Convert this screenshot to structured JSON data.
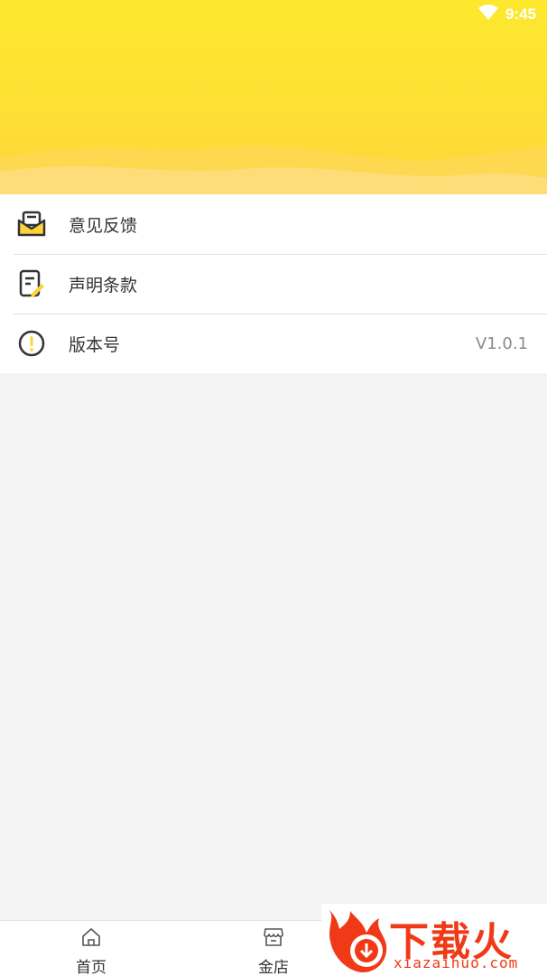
{
  "status_bar": {
    "time": "9:45",
    "wifi_icon": "wifi-icon"
  },
  "menu": {
    "items": [
      {
        "label": "意见反馈",
        "icon": "mail-feedback-icon",
        "value": ""
      },
      {
        "label": "声明条款",
        "icon": "document-edit-icon",
        "value": ""
      },
      {
        "label": "版本号",
        "icon": "info-exclamation-icon",
        "value": "V1.0.1"
      }
    ]
  },
  "tabbar": {
    "tabs": [
      {
        "label": "首页",
        "icon": "home-icon"
      },
      {
        "label": "金店",
        "icon": "shop-icon"
      }
    ]
  },
  "watermark": {
    "title": "下载火",
    "subtitle": "xiazaihuo.com"
  },
  "colors": {
    "header_yellow": "#fee233",
    "accent_yellow": "#fcd33a",
    "watermark_red": "#f03a17"
  }
}
